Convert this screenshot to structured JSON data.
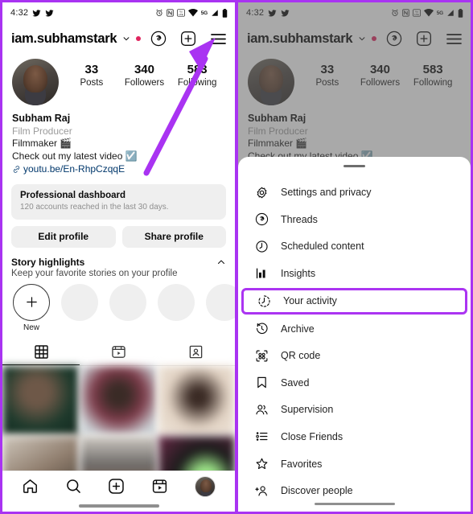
{
  "status_bar": {
    "time": "4:32",
    "network_label": "5G",
    "icons": [
      "twitter-icon",
      "twitter-icon",
      "alarm-icon",
      "nfc-icon",
      "volte-icon",
      "wifi-icon",
      "signal-icon",
      "battery-icon"
    ]
  },
  "app_header": {
    "username": "iam.subhamstark",
    "has_unread_dot": true,
    "actions": [
      "threads-icon",
      "add-post-icon",
      "hamburger-menu-icon"
    ]
  },
  "profile": {
    "stats": [
      {
        "number": "33",
        "label": "Posts"
      },
      {
        "number": "340",
        "label": "Followers"
      },
      {
        "number": "583",
        "label": "Following"
      }
    ],
    "name": "Subham Raj",
    "category": "Film Producer",
    "bio_line": "Filmmaker 🎬",
    "bio_line2": "Check out my latest video ☑️",
    "link": "youtu.be/En-RhpCzqqE"
  },
  "dashboard": {
    "title": "Professional dashboard",
    "subtitle": "120 accounts reached in the last 30 days."
  },
  "buttons": {
    "edit_profile": "Edit profile",
    "share_profile": "Share profile"
  },
  "story_highlights": {
    "title": "Story highlights",
    "subtitle": "Keep your favorite stories on your profile",
    "new_label": "New",
    "blank_count": 4
  },
  "content_tabs": [
    {
      "name": "grid-tab",
      "icon": "grid-icon",
      "active": true
    },
    {
      "name": "reels-tab",
      "icon": "reels-icon",
      "active": false
    },
    {
      "name": "tagged-tab",
      "icon": "tagged-icon",
      "active": false
    }
  ],
  "post_grid": {
    "cells": [
      "#3d5a4a",
      "#cfd3d6",
      "#e8ded2",
      "#dad4cc",
      "#b8b0a6",
      "#6b2a48"
    ]
  },
  "bottom_nav": [
    {
      "name": "home-icon",
      "label": "Home"
    },
    {
      "name": "search-icon",
      "label": "Search"
    },
    {
      "name": "create-icon",
      "label": "Create"
    },
    {
      "name": "reels-icon",
      "label": "Reels"
    },
    {
      "name": "profile-avatar",
      "label": "Profile"
    }
  ],
  "menu_sheet": {
    "items": [
      {
        "icon": "settings-gear-icon",
        "label": "Settings and privacy",
        "highlighted": false
      },
      {
        "icon": "threads-icon",
        "label": "Threads",
        "highlighted": false
      },
      {
        "icon": "scheduled-clock-icon",
        "label": "Scheduled content",
        "highlighted": false
      },
      {
        "icon": "insights-bar-icon",
        "label": "Insights",
        "highlighted": false
      },
      {
        "icon": "your-activity-icon",
        "label": "Your activity",
        "highlighted": true
      },
      {
        "icon": "archive-icon",
        "label": "Archive",
        "highlighted": false
      },
      {
        "icon": "qr-code-icon",
        "label": "QR code",
        "highlighted": false
      },
      {
        "icon": "saved-bookmark-icon",
        "label": "Saved",
        "highlighted": false
      },
      {
        "icon": "supervision-icon",
        "label": "Supervision",
        "highlighted": false
      },
      {
        "icon": "close-friends-icon",
        "label": "Close Friends",
        "highlighted": false
      },
      {
        "icon": "favorites-star-icon",
        "label": "Favorites",
        "highlighted": false
      },
      {
        "icon": "discover-people-icon",
        "label": "Discover people",
        "highlighted": false
      }
    ]
  },
  "annotation": {
    "arrow_color": "#a933f2",
    "highlight_color": "#ab34f2",
    "points_to": "hamburger-menu-icon"
  }
}
